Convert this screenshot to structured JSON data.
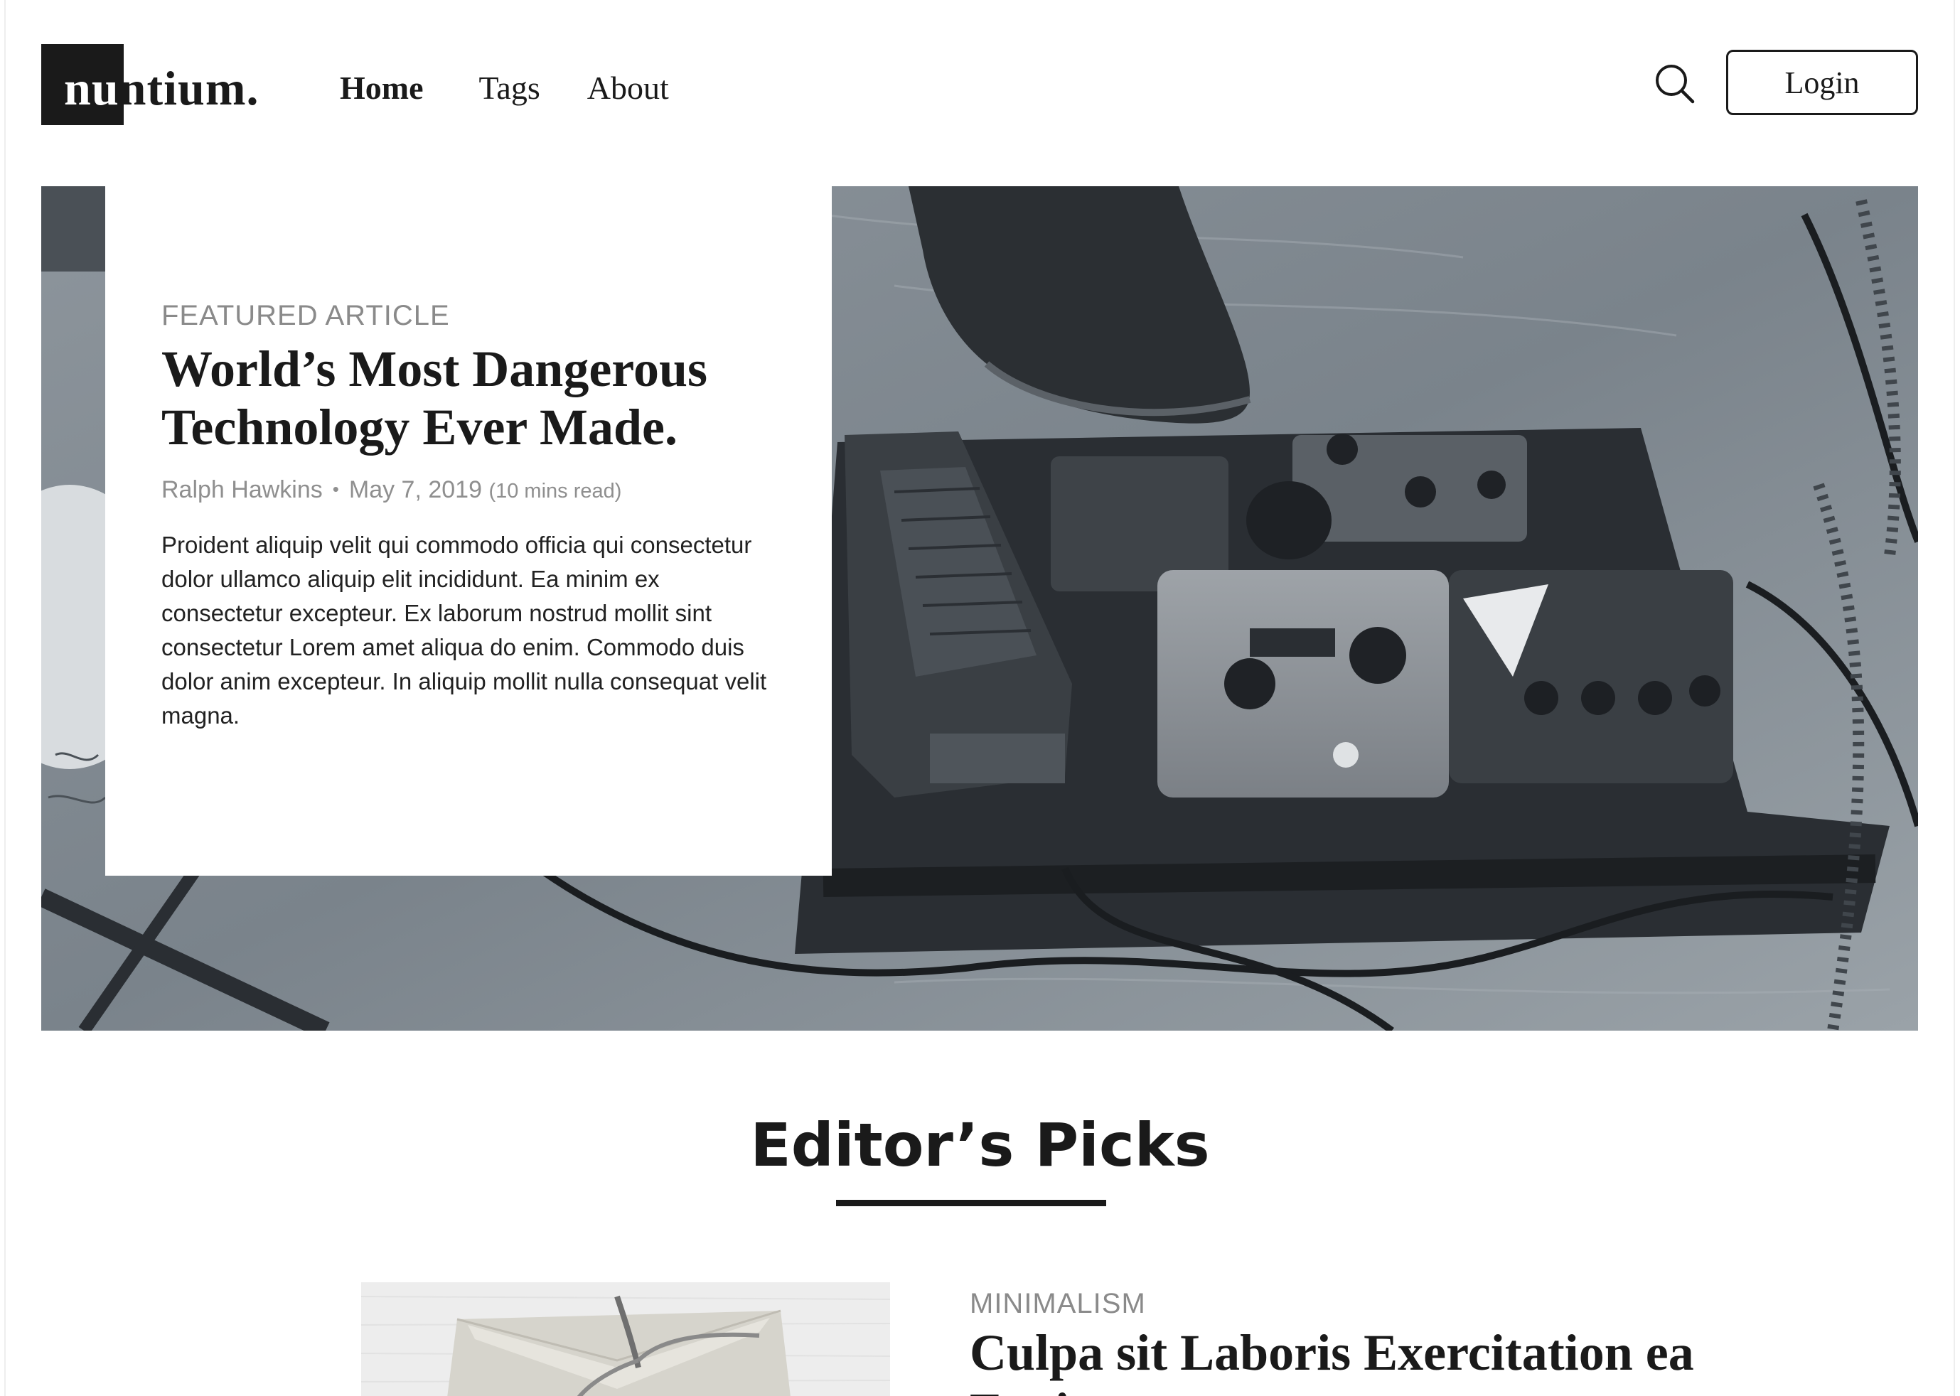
{
  "brand": {
    "logo_text": "nuntium."
  },
  "nav": {
    "items": [
      {
        "label": "Home",
        "active": true
      },
      {
        "label": "Tags",
        "active": false
      },
      {
        "label": "About",
        "active": false
      }
    ]
  },
  "header": {
    "search_icon": "search-icon",
    "login_label": "Login"
  },
  "featured": {
    "label": "FEATURED ARTICLE",
    "title_line1": "World’s Most Dangerous",
    "title_line2": "Technology Ever Made.",
    "author": "Ralph Hawkins",
    "separator": "•",
    "date": "May 7, 2019",
    "read_time": "(10 mins read)",
    "excerpt": "Proident aliquip velit qui commodo officia qui consectetur dolor ullamco aliquip elit incididunt. Ea minim ex consectetur excepteur. Ex laborum nostrud mollit sint consectetur Lorem amet aliqua do enim. Commodo duis dolor anim excepteur. In aliquip mollit nulla consequat velit magna.",
    "image": "guitar effects pedalboard photo"
  },
  "editors_picks": {
    "title": "Editor’s Picks",
    "items": [
      {
        "category": "MINIMALISM",
        "title": "Culpa sit Laboris Exercitation ea Fugiat",
        "image": "envelope with ribbon photo"
      }
    ]
  },
  "colors": {
    "text": "#1a1a1a",
    "muted": "#8a8a8a",
    "hero_tint": "#6f7880"
  }
}
